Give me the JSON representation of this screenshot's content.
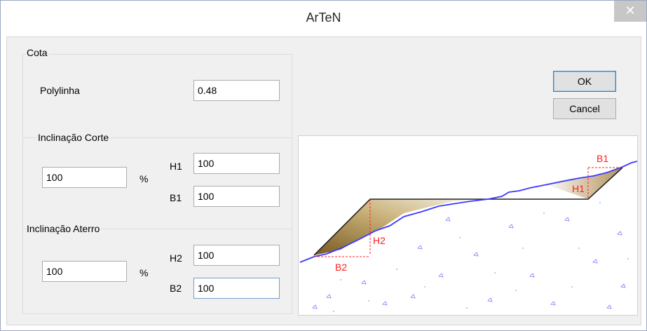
{
  "window": {
    "title": "ArTeN",
    "close_glyph": "✕"
  },
  "group_cota": {
    "label": "Cota"
  },
  "polylinha": {
    "label": "Polylinha",
    "value": "0.48"
  },
  "corte": {
    "label": "Inclinação Corte",
    "percent_value": "100",
    "percent_symbol": "%",
    "h_label": "H1",
    "h_value": "100",
    "b_label": "B1",
    "b_value": "100"
  },
  "aterro": {
    "label": "Inclinação Aterro",
    "percent_value": "100",
    "percent_symbol": "%",
    "h_label": "H2",
    "h_value": "100",
    "b_label": "B2",
    "b_value": "100"
  },
  "buttons": {
    "ok": "OK",
    "cancel": "Cancel"
  },
  "diagram": {
    "labels": {
      "b1": "B1",
      "h1": "H1",
      "h2": "H2",
      "b2": "B2"
    },
    "colors": {
      "ground_line": "#3a3aff",
      "dimension": "#ff2020",
      "earth_dark": "#8a6a2a",
      "earth_light": "#f4f0e6"
    }
  }
}
